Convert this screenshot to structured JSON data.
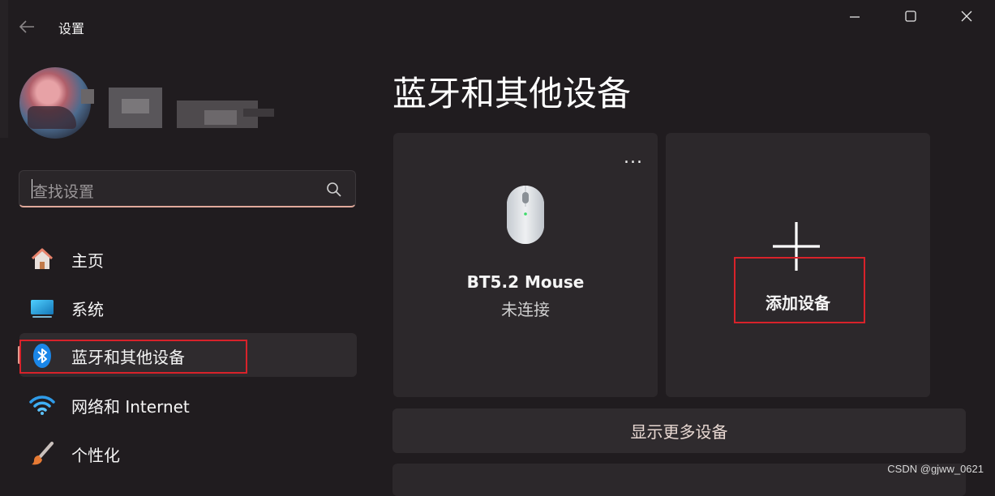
{
  "window": {
    "title": "设置",
    "minimize_glyph": "—",
    "maximize_icon": "maximize-icon",
    "close_icon": "close-icon"
  },
  "profile": {
    "avatar_icon": "user-avatar"
  },
  "search": {
    "placeholder": "查找设置",
    "icon": "search-icon"
  },
  "sidebar": {
    "items": [
      {
        "label": "主页",
        "icon": "home-icon"
      },
      {
        "label": "系统",
        "icon": "system-icon"
      },
      {
        "label": "蓝牙和其他设备",
        "icon": "bluetooth-icon",
        "active": true
      },
      {
        "label": "网络和 Internet",
        "icon": "wifi-icon"
      },
      {
        "label": "个性化",
        "icon": "brush-icon"
      }
    ]
  },
  "main": {
    "title": "蓝牙和其他设备",
    "devices": [
      {
        "name": "BT5.2 Mouse",
        "status": "未连接",
        "icon": "mouse-icon",
        "menu": "..."
      }
    ],
    "add_device": {
      "label": "添加设备",
      "icon": "plus-icon"
    },
    "show_more": "显示更多设备"
  },
  "watermark": "CSDN @gjww_0621",
  "colors": {
    "background": "#201c1f",
    "card": "#2c282b",
    "accent": "#e59b8f",
    "highlight_box": "#d8222a"
  }
}
